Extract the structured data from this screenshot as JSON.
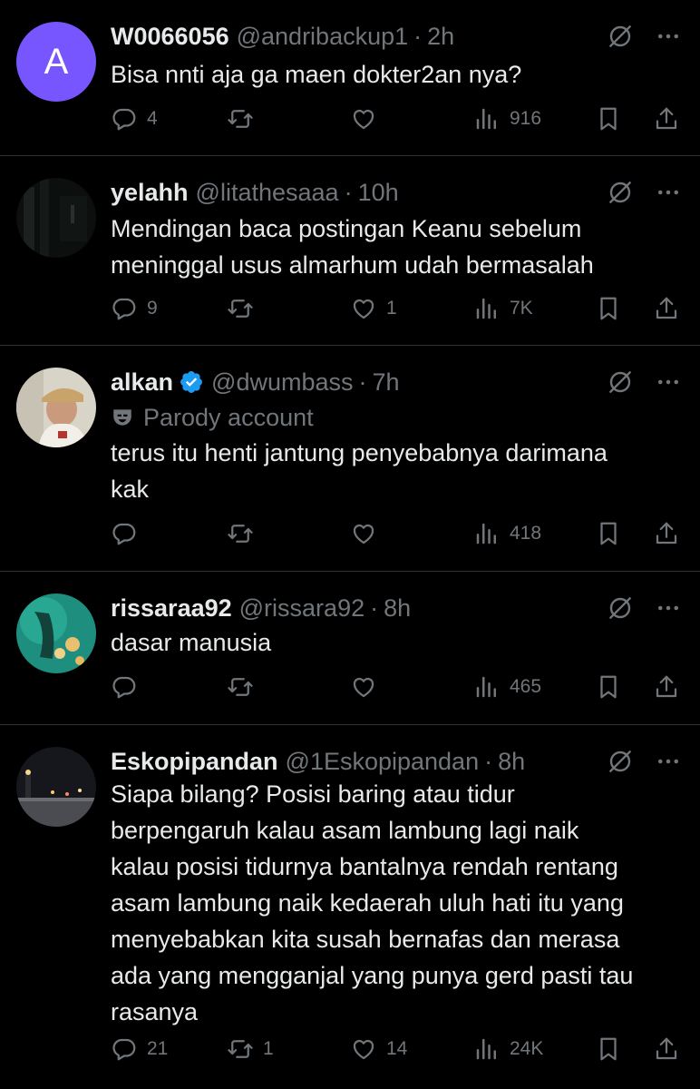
{
  "tweets": [
    {
      "name": "W0066056",
      "handle": "@andribackup1",
      "time": "2h",
      "avatar_letter": "A",
      "verified": false,
      "parody_label": "",
      "text": [
        "Bisa nnti aja ga maen dokter2an nya?"
      ],
      "replies": "4",
      "retweets": "",
      "likes": "",
      "views": "916"
    },
    {
      "name": "yelahh",
      "handle": "@litathesaaa",
      "time": "10h",
      "avatar_letter": "",
      "verified": false,
      "parody_label": "",
      "text": [
        "Mendingan baca postingan Keanu sebelum",
        "meninggal usus almarhum udah bermasalah"
      ],
      "replies": "9",
      "retweets": "",
      "likes": "1",
      "views": "7K"
    },
    {
      "name": "alkan",
      "handle": "@dwumbass",
      "time": "7h",
      "avatar_letter": "",
      "verified": true,
      "parody_label": "Parody account",
      "text": [
        "terus itu henti jantung penyebabnya darimana",
        "kak"
      ],
      "replies": "",
      "retweets": "",
      "likes": "",
      "views": "418"
    },
    {
      "name": "rissaraa92",
      "handle": "@rissara92",
      "time": "8h",
      "avatar_letter": "",
      "verified": false,
      "parody_label": "",
      "text": [
        "dasar manusia"
      ],
      "replies": "",
      "retweets": "",
      "likes": "",
      "views": "465"
    },
    {
      "name": "Eskopipandan",
      "handle": "@1Eskopipandan",
      "time": "8h",
      "avatar_letter": "",
      "verified": false,
      "parody_label": "",
      "text": [
        "Siapa bilang? Posisi baring atau tidur",
        "berpengaruh kalau asam lambung lagi naik",
        "kalau posisi tidurnya bantalnya rendah rentang",
        "asam lambung naik kedaerah uluh hati itu yang",
        "menyebabkan kita susah bernafas dan merasa",
        "ada yang mengganjal yang punya gerd pasti tau",
        "rasanya"
      ],
      "replies": "21",
      "retweets": "1",
      "likes": "14",
      "views": "24K"
    }
  ],
  "colors": {
    "background": "#000000",
    "text": "#e7e9ea",
    "muted": "#71767b",
    "divider": "#2f3336",
    "verified": "#1d9bf0",
    "avatar_default": "#7856ff"
  },
  "icons": [
    "reply-icon",
    "retweet-icon",
    "like-icon",
    "views-icon",
    "bookmark-icon",
    "share-icon",
    "grok-icon",
    "more-icon",
    "verified-badge-icon",
    "parody-mask-icon"
  ]
}
